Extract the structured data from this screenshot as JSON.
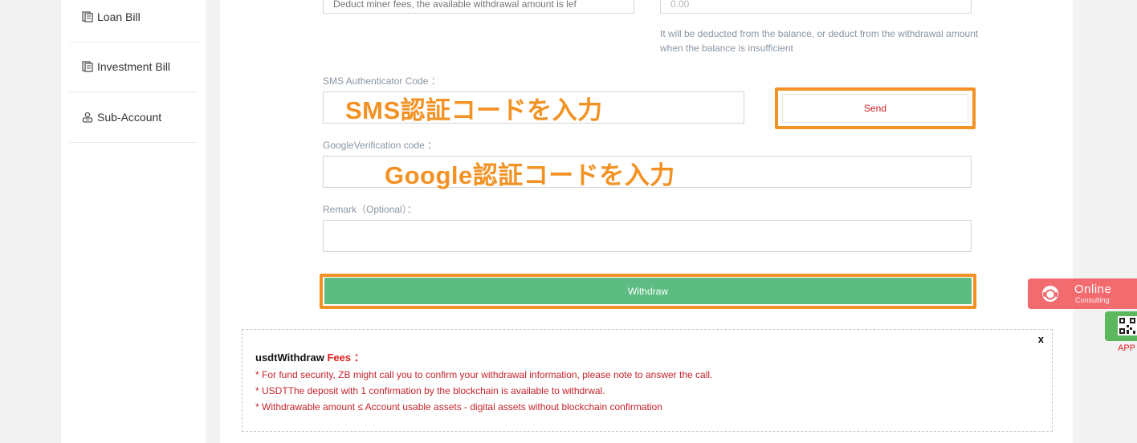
{
  "sidebar": {
    "items": [
      {
        "label": "Loan Bill",
        "icon": "bill-icon"
      },
      {
        "label": "Investment Bill",
        "icon": "bill-icon"
      },
      {
        "label": "Sub-Account",
        "icon": "account-icon"
      }
    ]
  },
  "form": {
    "address_partial": {
      "placeholder": "Deduct miner fees, the available withdrawal amount is lef"
    },
    "fee_partial": {
      "value": "0.00"
    },
    "fee_hint": "It will be deducted from the balance, or deduct from the withdrawal amount when the balance is insufficient",
    "sms": {
      "label": "SMS Authenticator Code ：",
      "overlay": "SMS認証コードを入力",
      "send_label": "Send"
    },
    "google": {
      "label": "GoogleVerification code ：",
      "overlay": "Google認証コードを入力"
    },
    "remark": {
      "label": "Remark（Optional）："
    },
    "withdraw_label": "Withdraw"
  },
  "fees": {
    "title_prefix": "usdtWithdraw",
    "title_red": "Fees ：",
    "close": "x",
    "lines": [
      "* For fund security, ZB might call you to confirm your withdrawal information, please note to answer the call.",
      "* USDTThe deposit with 1 confirmation by the blockchain is available to withdrwal.",
      "* Withdrawable amount ≤ Account usable assets - digital assets without blockchain confirmation"
    ]
  },
  "float": {
    "online_title": "Online",
    "online_sub": "Consulting",
    "app_label": "APP"
  },
  "colors": {
    "highlight": "#f39224",
    "primary_green": "#5cbc82",
    "notice_red": "#c5232b",
    "consult_pink": "#f16b6f"
  }
}
